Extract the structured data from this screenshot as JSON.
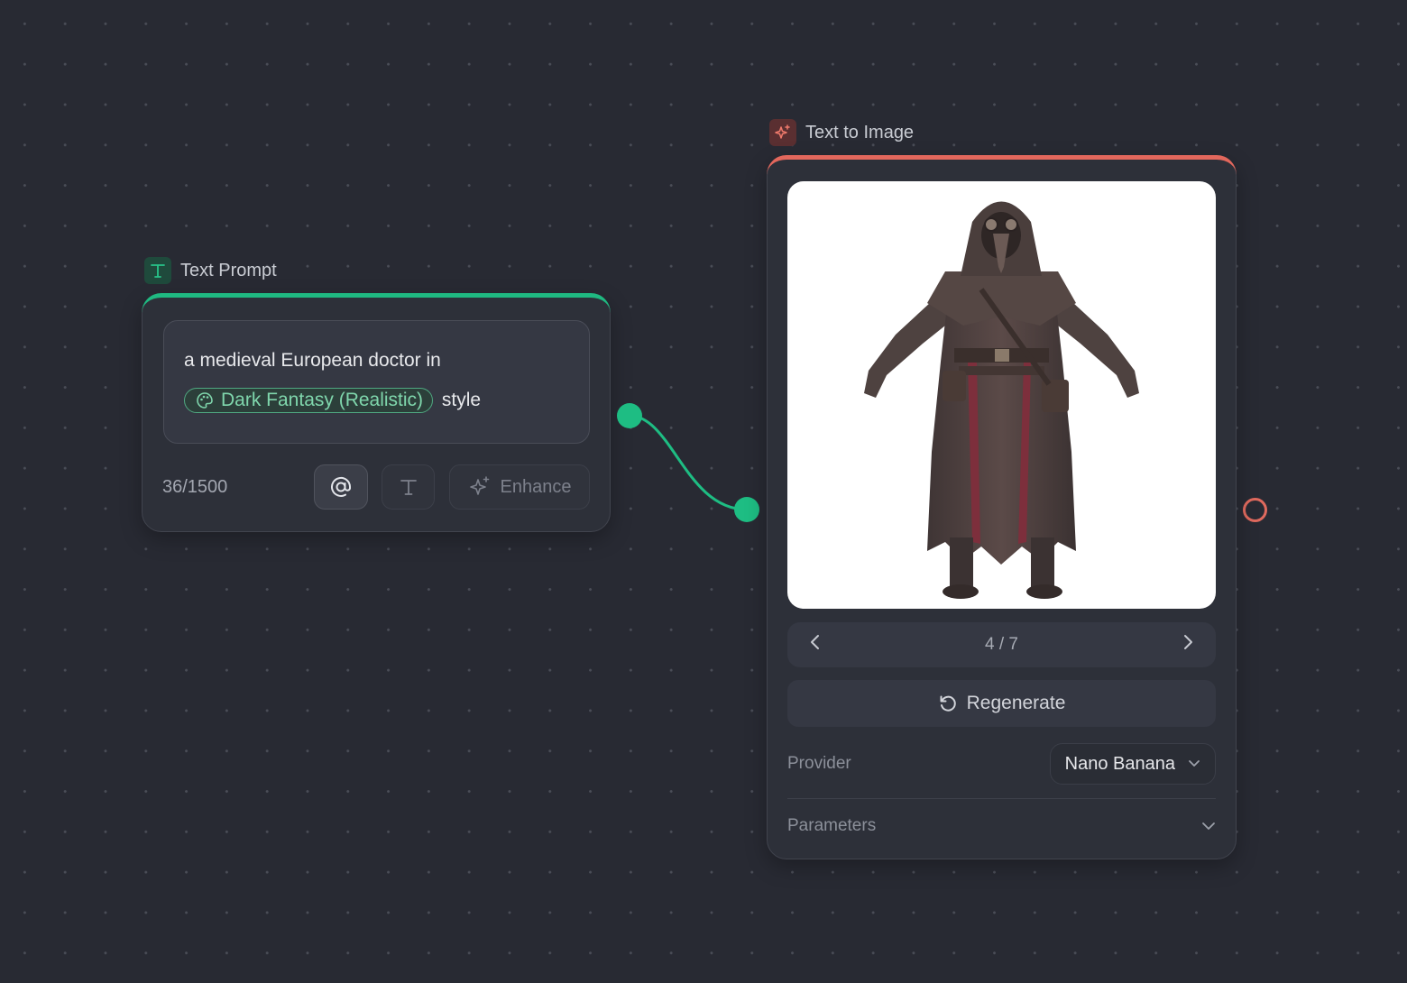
{
  "text_prompt_node": {
    "title": "Text Prompt",
    "prompt_text_before": "a medieval European doctor in",
    "style_chip": "Dark Fantasy (Realistic)",
    "prompt_text_after": "style",
    "char_count": "36/1500",
    "enhance_label": "Enhance",
    "accent_color": "#1fb981"
  },
  "text_to_image_node": {
    "title": "Text to Image",
    "pager_label": "4 / 7",
    "regenerate_label": "Regenerate",
    "provider_label": "Provider",
    "provider_value": "Nano Banana",
    "parameters_label": "Parameters",
    "accent_color": "#e2675c",
    "image_subject": "plague doctor figure"
  },
  "icons": [
    "text-icon",
    "sparkle-icon",
    "palette-icon",
    "at-icon",
    "text-format-icon",
    "enhance-sparkle-icon",
    "chevron-left-icon",
    "chevron-right-icon",
    "regenerate-icon",
    "chevron-down-icon"
  ]
}
